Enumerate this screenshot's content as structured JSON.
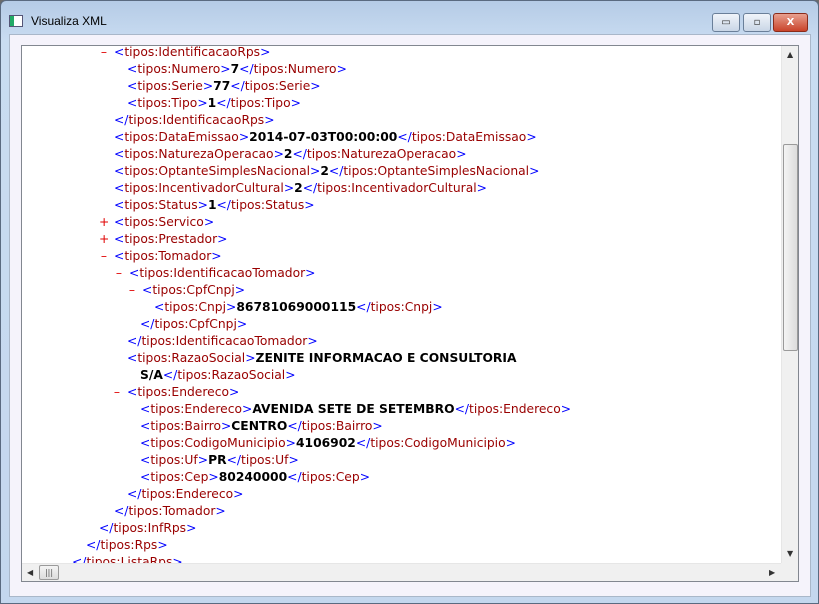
{
  "window": {
    "title": "Visualiza XML",
    "minimize": "▭",
    "maximize": "▫",
    "close": "X"
  },
  "colors": {
    "bracket": "#0000ff",
    "tag": "#990000",
    "value": "#000000",
    "marker": "#e00000"
  },
  "xml_lines": [
    {
      "marker": "–",
      "open": "tipos:IdentificacaoRps"
    },
    {
      "open": "tipos:Numero",
      "value": "7",
      "close": "tipos:Numero"
    },
    {
      "open": "tipos:Serie",
      "value": "77",
      "close": "tipos:Serie"
    },
    {
      "open": "tipos:Tipo",
      "value": "1",
      "close": "tipos:Tipo"
    },
    {
      "close": "tipos:IdentificacaoRps"
    },
    {
      "open": "tipos:DataEmissao",
      "value": "2014-07-03T00:00:00",
      "close": "tipos:DataEmissao"
    },
    {
      "open": "tipos:NaturezaOperacao",
      "value": "2",
      "close": "tipos:NaturezaOperacao"
    },
    {
      "open": "tipos:OptanteSimplesNacional",
      "value": "2",
      "close": "tipos:OptanteSimplesNacional"
    },
    {
      "open": "tipos:IncentivadorCultural",
      "value": "2",
      "close": "tipos:IncentivadorCultural"
    },
    {
      "open": "tipos:Status",
      "value": "1",
      "close": "tipos:Status"
    },
    {
      "marker": "+",
      "open": "tipos:Servico"
    },
    {
      "marker": "+",
      "open": "tipos:Prestador"
    },
    {
      "marker": "–",
      "open": "tipos:Tomador"
    },
    {
      "marker": "–",
      "open": "tipos:IdentificacaoTomador"
    },
    {
      "marker": "–",
      "open": "tipos:CpfCnpj"
    },
    {
      "open": "tipos:Cnpj",
      "value": "86781069000115",
      "close": "tipos:Cnpj"
    },
    {
      "close": "tipos:CpfCnpj"
    },
    {
      "close": "tipos:IdentificacaoTomador"
    },
    {
      "open": "tipos:RazaoSocial",
      "value": "ZENITE INFORMACAO E CONSULTORIA"
    },
    {
      "value": "S/A",
      "close": "tipos:RazaoSocial"
    },
    {
      "marker": "–",
      "open": "tipos:Endereco"
    },
    {
      "open": "tipos:Endereco",
      "value": "AVENIDA SETE DE SETEMBRO",
      "close": "tipos:Endereco"
    },
    {
      "open": "tipos:Bairro",
      "value": "CENTRO",
      "close": "tipos:Bairro"
    },
    {
      "open": "tipos:CodigoMunicipio",
      "value": "4106902",
      "close": "tipos:CodigoMunicipio"
    },
    {
      "open": "tipos:Uf",
      "value": "PR",
      "close": "tipos:Uf"
    },
    {
      "open": "tipos:Cep",
      "value": "80240000",
      "close": "tipos:Cep"
    },
    {
      "close": "tipos:Endereco"
    },
    {
      "close": "tipos:Tomador"
    },
    {
      "close": "tipos:InfRps"
    },
    {
      "close": "tipos:Rps"
    },
    {
      "close": "tipos:ListaRps"
    }
  ]
}
